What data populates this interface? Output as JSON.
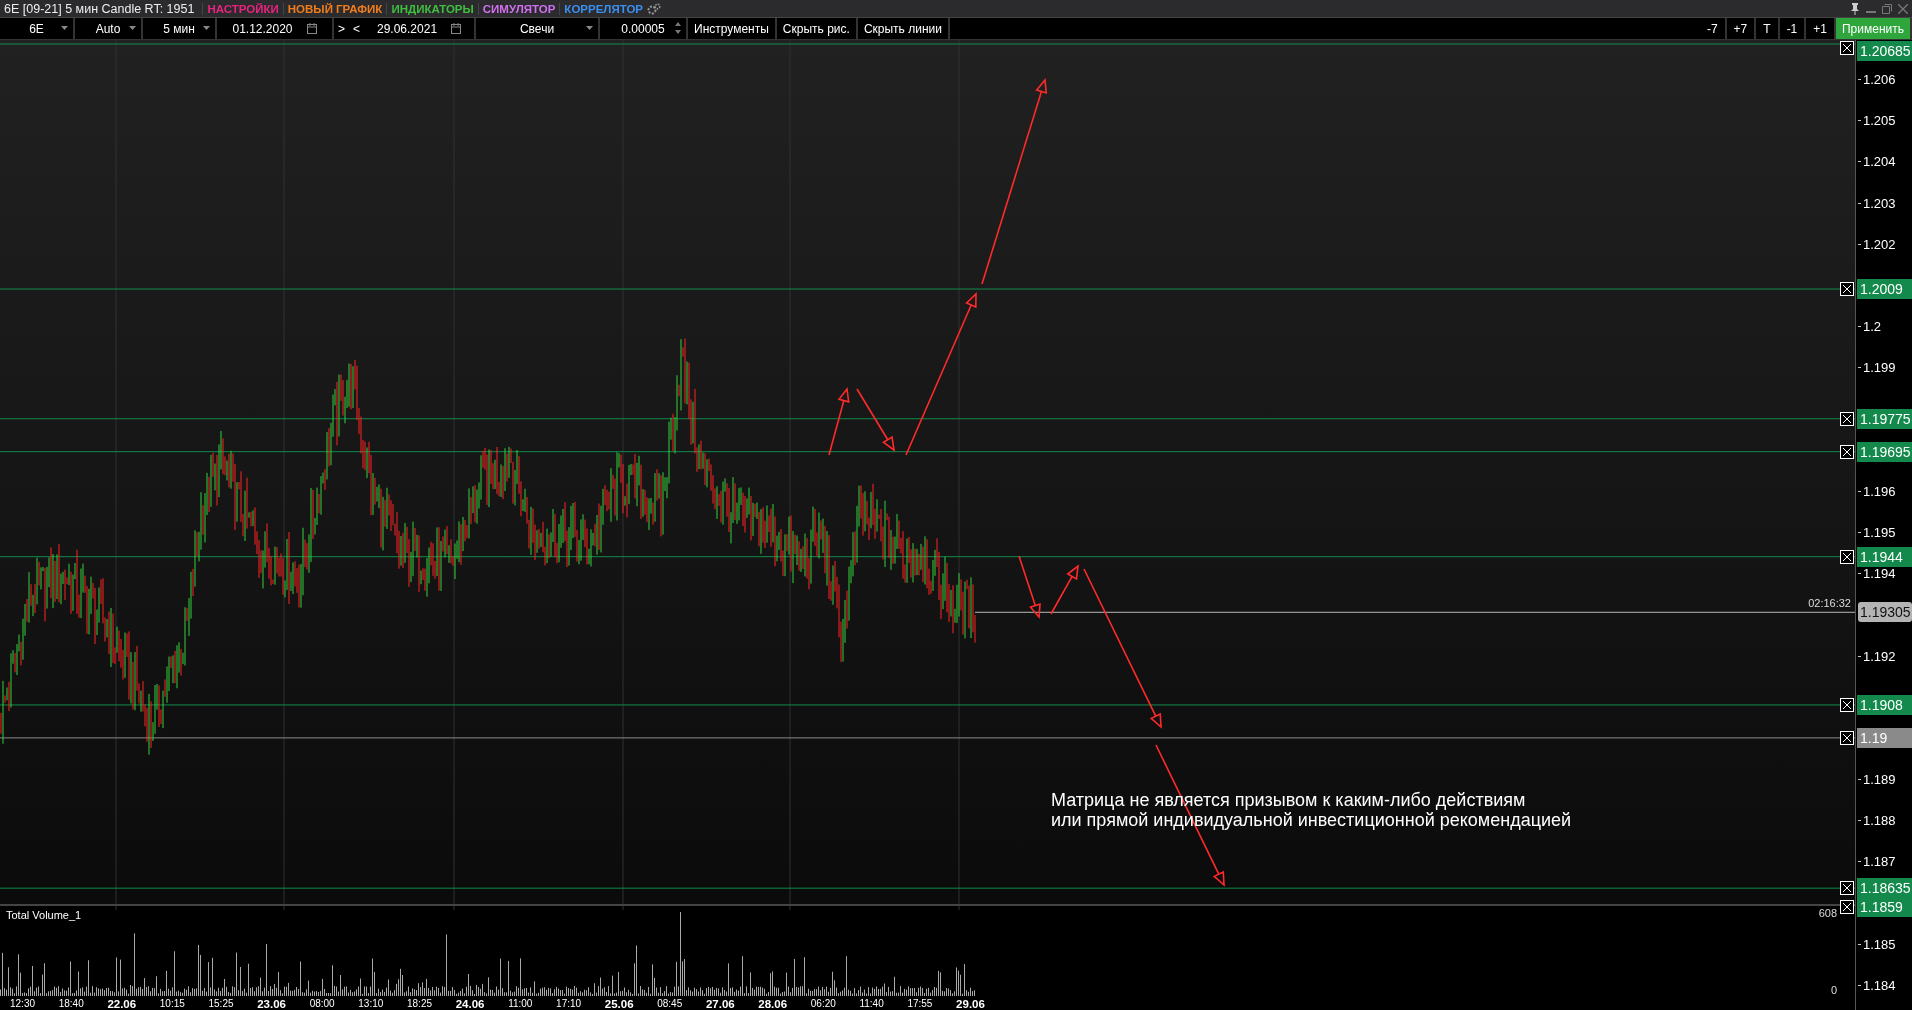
{
  "window": {
    "title": "6E [09-21] 5 мин Candle RT: 1951",
    "menu": [
      {
        "label": "НАСТРОЙКИ",
        "color": "#e8237f"
      },
      {
        "label": "НОВЫЙ ГРАФИК",
        "color": "#f07c1c"
      },
      {
        "label": "ИНДИКАТОРЫ",
        "color": "#3fbf3f"
      },
      {
        "label": "СИМУЛЯТОР",
        "color": "#d070f0"
      },
      {
        "label": "КОРРЕЛЯТОР",
        "color": "#3b8ff0"
      }
    ]
  },
  "toolbar": {
    "symbol": "6E",
    "mode": "Auto",
    "timeframe": "5 мин",
    "date_from": "01.12.2020",
    "nav": [
      ">",
      "<"
    ],
    "date_to": "29.06.2021",
    "chart_type": "Свечи",
    "step": "0.00005",
    "buttons": [
      "Инструменты",
      "Скрыть рис.",
      "Скрыть линии"
    ],
    "shift_buttons": [
      "-7",
      "+7",
      "T",
      "-1",
      "+1"
    ],
    "apply": "Применить"
  },
  "chart": {
    "price_ticks": [
      "1.206",
      "1.205",
      "1.204",
      "1.203",
      "1.202",
      "1.2",
      "1.199",
      "1.196",
      "1.195",
      "1.194",
      "1.192",
      "1.189",
      "1.188",
      "1.187",
      "1.185",
      "1.184"
    ],
    "levels": [
      {
        "label": "1.20685",
        "color": "#138a4c"
      },
      {
        "label": "1.2009",
        "color": "#138a4c"
      },
      {
        "label": "1.19775",
        "color": "#138a4c"
      },
      {
        "label": "1.19695",
        "color": "#138a4c"
      },
      {
        "label": "1.1944",
        "color": "#138a4c"
      },
      {
        "label": "1.1908",
        "color": "#138a4c"
      },
      {
        "label": "1.19",
        "color": "#8a8a8a"
      },
      {
        "label": "1.18635",
        "color": "#138a4c"
      },
      {
        "label": "1.1859",
        "color": "#138a4c"
      }
    ],
    "current_price": {
      "label": "1.19305",
      "time": "02:16:32"
    },
    "note": [
      "Матрица не является призывом к каким-либо действиям",
      "или прямой индивидуальной инвестиционной рекомендацией"
    ]
  },
  "volume": {
    "title": "Total Volume_1",
    "max": "608",
    "min": "0"
  },
  "time_axis": [
    {
      "label": "12:30",
      "kind": "time"
    },
    {
      "label": "18:40",
      "kind": "time"
    },
    {
      "label": "22.06",
      "kind": "date"
    },
    {
      "label": "10:15",
      "kind": "time"
    },
    {
      "label": "15:25",
      "kind": "time"
    },
    {
      "label": "23.06",
      "kind": "date"
    },
    {
      "label": "08:00",
      "kind": "time"
    },
    {
      "label": "13:10",
      "kind": "time"
    },
    {
      "label": "18:25",
      "kind": "time"
    },
    {
      "label": "24.06",
      "kind": "date"
    },
    {
      "label": "11:00",
      "kind": "time"
    },
    {
      "label": "17:10",
      "kind": "time"
    },
    {
      "label": "25.06",
      "kind": "date"
    },
    {
      "label": "08:45",
      "kind": "time"
    },
    {
      "label": "27.06",
      "kind": "date"
    },
    {
      "label": "28.06",
      "kind": "date"
    },
    {
      "label": "06:20",
      "kind": "time"
    },
    {
      "label": "11:40",
      "kind": "time"
    },
    {
      "label": "17:55",
      "kind": "time"
    },
    {
      "label": "29.06",
      "kind": "date"
    }
  ]
}
